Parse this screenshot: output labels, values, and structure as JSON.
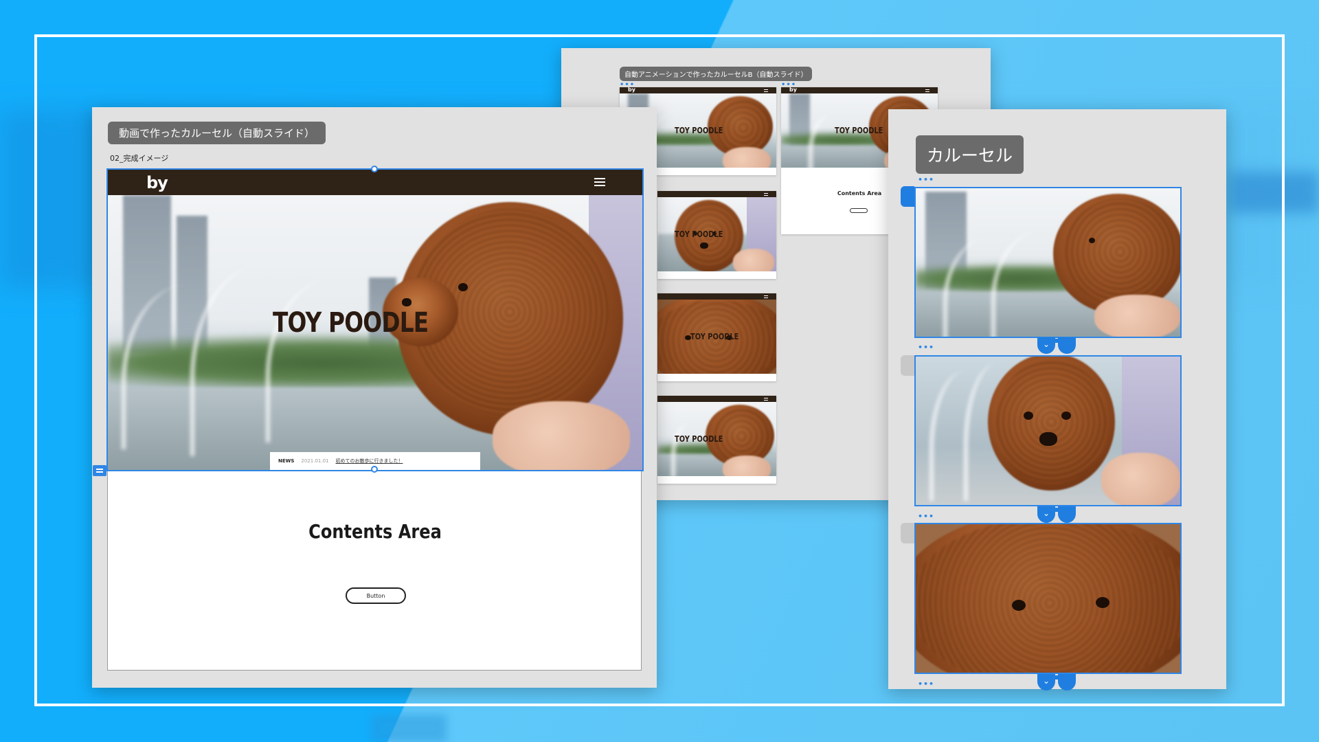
{
  "main_artboard": {
    "tag": "動画で作ったカルーセル（自動スライド）",
    "label": "02_完成イメージ",
    "site": {
      "logo": "by",
      "hero_title": "TOY POODLE",
      "news": {
        "label": "NEWS",
        "date": "2021.01.01",
        "text": "初めてのお散歩に行きました！"
      },
      "contents_title": "Contents Area",
      "button_label": "Button"
    }
  },
  "carousel_b_artboard": {
    "tag": "自動アニメーションで作ったカルーセルB（自動スライド）",
    "frame_logo": "by",
    "frame_title": "TOY POODLE",
    "frame_contents_title": "Contents Area",
    "dots": "•••"
  },
  "carousel_artboard": {
    "tag": "カルーセル",
    "dots": "•••",
    "chevron": "⌄"
  },
  "colors": {
    "background_primary": "#12aefc",
    "background_secondary": "#5ec8fa",
    "selection_blue": "#2f86e6",
    "header_brown": "#2f2217",
    "artboard_gray": "#e1e1e1",
    "tag_gray": "#6b6b6b"
  }
}
